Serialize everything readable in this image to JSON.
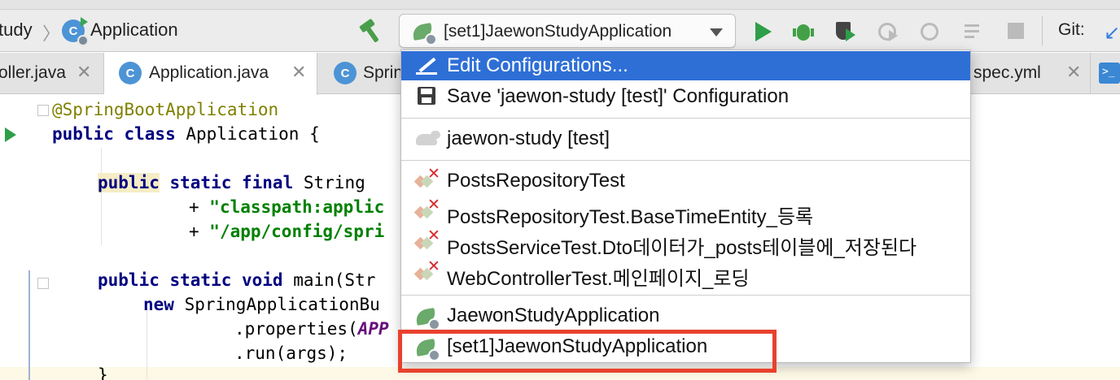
{
  "toolbar": {
    "breadcrumb_project": "tudy",
    "breadcrumb_file": "Application",
    "run_config": "[set1]JaewonStudyApplication",
    "git_label": "Git:"
  },
  "tabs": [
    {
      "label": "oller.java",
      "close": "✕"
    },
    {
      "label": "Application.java",
      "close": "✕",
      "icon": "C"
    },
    {
      "label": "Sprin",
      "icon": "C"
    },
    {
      "label": "spec.yml",
      "close": "✕"
    }
  ],
  "editor": {
    "lines": [
      {
        "annotation": "@SpringBootApplication"
      },
      {
        "kw1": "public class",
        "rest": " Application {"
      },
      {
        "kw1": "public",
        "kw2": " static final",
        "rest": " String "
      },
      {
        "plus": "+ ",
        "str": "\"classpath:applic"
      },
      {
        "plus": "+ ",
        "str": "\"/app/config/spri"
      },
      {
        "kw1": "public static void",
        "rest": " main(Str"
      },
      {
        "kw1": "new",
        "rest": " SpringApplicationBu"
      },
      {
        "pre": ".properties(",
        "const": "APP"
      },
      {
        "pre": ".run(args);"
      },
      {
        "pre": "}"
      }
    ]
  },
  "menu": {
    "items": [
      {
        "label": "Edit Configurations...",
        "icon": "pencil-icon",
        "selected": true
      },
      {
        "label": "Save 'jaewon-study [test]' Configuration",
        "icon": "save-icon"
      },
      {
        "label": "jaewon-study [test]",
        "icon": "gradle-icon"
      },
      {
        "label": "PostsRepositoryTest",
        "icon": "junit-failed-icon"
      },
      {
        "label": "PostsRepositoryTest.BaseTimeEntity_등록",
        "icon": "junit-failed-icon"
      },
      {
        "label": "PostsServiceTest.Dto데이터가_posts테이블에_저장된다",
        "icon": "junit-failed-icon"
      },
      {
        "label": "WebControllerTest.메인페이지_로딩",
        "icon": "junit-failed-icon"
      },
      {
        "label": "JaewonStudyApplication",
        "icon": "spring-boot-icon"
      },
      {
        "label": "[set1]JaewonStudyApplication",
        "icon": "spring-boot-icon"
      }
    ]
  },
  "colors": {
    "selection": "#2e6fd6",
    "highlight_box": "#e8412e",
    "run_green": "#2e9e48"
  }
}
